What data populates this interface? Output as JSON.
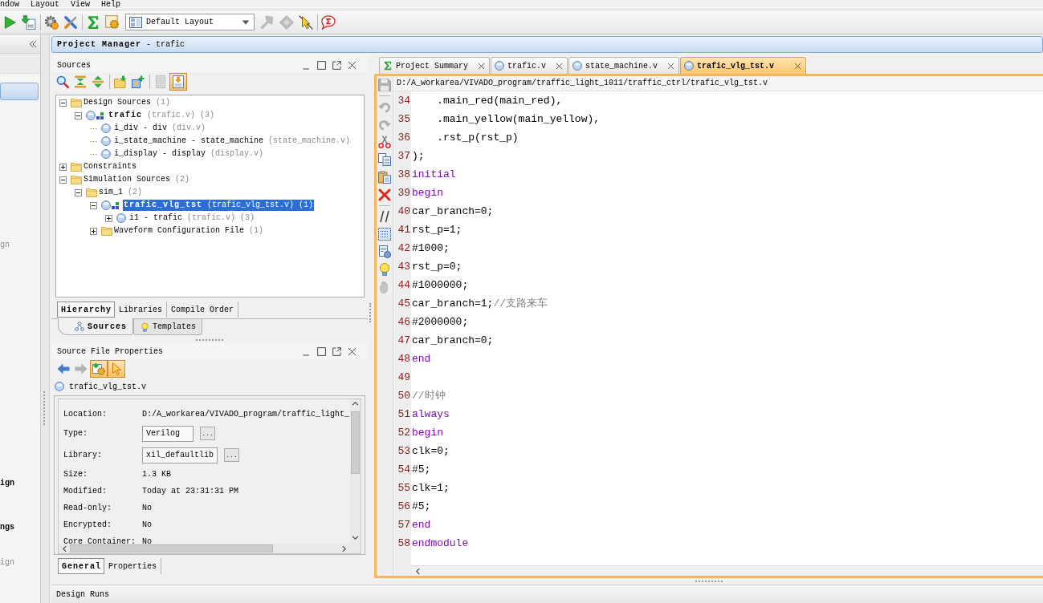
{
  "menu_bar": [
    {
      "label": "ndow"
    },
    {
      "label": "Layout"
    },
    {
      "label": "View"
    },
    {
      "label": "Help"
    }
  ],
  "toolbar": {
    "left_groups": [
      [
        {
          "kind": "run",
          "disabled": false
        },
        {
          "kind": "program",
          "disabled": false
        }
      ],
      [
        {
          "kind": "settings",
          "disabled": false
        },
        {
          "kind": "tools",
          "disabled": false
        }
      ],
      [
        {
          "kind": "summary",
          "disabled": false
        },
        {
          "kind": "ip",
          "disabled": false
        }
      ]
    ],
    "layout_dropdown": {
      "value": "Default Layout"
    },
    "right_groups": [
      [
        {
          "kind": "pin",
          "disabled": true
        },
        {
          "kind": "chip",
          "disabled": true
        },
        {
          "kind": "probe",
          "disabled": false
        }
      ],
      [
        {
          "kind": "chat",
          "disabled": false
        }
      ]
    ]
  },
  "flow_navigator": {
    "items": [
      {
        "selected": true
      },
      {
        "text": "gn",
        "disabled": true,
        "selected": false
      },
      {
        "text": "ign",
        "disabled": false,
        "selected": false
      },
      {
        "text": "ngs",
        "disabled": false,
        "selected": false
      },
      {
        "text": "ign",
        "disabled": true,
        "selected": false
      }
    ]
  },
  "project_manager": {
    "title": "Project Manager",
    "project": "- trafic"
  },
  "sources_panel": {
    "title": "Sources",
    "toolbar_groups": [
      [
        {
          "kind": "search",
          "disabled": false,
          "pressed": false
        },
        {
          "kind": "collapse",
          "disabled": false,
          "pressed": false
        },
        {
          "kind": "expand",
          "disabled": false,
          "pressed": false
        }
      ],
      [
        {
          "kind": "open",
          "disabled": false,
          "pressed": false
        },
        {
          "kind": "add",
          "disabled": false,
          "pressed": false
        }
      ],
      [
        {
          "kind": "help",
          "disabled": true,
          "pressed": false
        },
        {
          "kind": "properties",
          "disabled": false,
          "pressed": true
        }
      ]
    ],
    "tree": [
      {
        "kind": "folder",
        "label": "Design Sources",
        "detail": "(1)",
        "expanded": true,
        "selected": false,
        "children": [
          {
            "kind": "top",
            "label": "trafic",
            "detail": "(trafic.v) (3)",
            "expanded": true,
            "selected": false,
            "children": [
              {
                "kind": "instance",
                "label": "i_div - div",
                "detail": "(div.v)",
                "selected": false
              },
              {
                "kind": "instance",
                "label": "i_state_machine - state_machine",
                "detail": "(state_machine.v)",
                "selected": false
              },
              {
                "kind": "instance",
                "label": "i_display - display",
                "detail": "(display.v)",
                "selected": false
              }
            ]
          }
        ]
      },
      {
        "kind": "folder",
        "label": "Constraints",
        "expanded": false,
        "selected": false
      },
      {
        "kind": "folder",
        "label": "Simulation Sources",
        "detail": "(2)",
        "expanded": true,
        "selected": false,
        "children": [
          {
            "kind": "folder",
            "label": "sim_1",
            "detail": "(2)",
            "expanded": true,
            "selected": false,
            "children": [
              {
                "kind": "top",
                "label": "trafic_vlg_tst",
                "detail": "(trafic_vlg_tst.v) (1)",
                "expanded": true,
                "selected": true,
                "children": [
                  {
                    "kind": "instance",
                    "label": "i1 - trafic",
                    "detail": "(trafic.v) (3)",
                    "expanded": false,
                    "selected": false
                  }
                ]
              },
              {
                "kind": "folder",
                "label": "Waveform Configuration File",
                "detail": "(1)",
                "expanded": false,
                "selected": false
              }
            ]
          }
        ]
      }
    ],
    "view_tabs": [
      {
        "label": "Hierarchy",
        "selected": true
      },
      {
        "label": "Libraries",
        "selected": false
      },
      {
        "label": "Compile Order",
        "selected": false
      }
    ]
  },
  "panel_tabs": [
    {
      "label": "Sources",
      "selected": true
    },
    {
      "label": "Templates",
      "selected": false
    }
  ],
  "properties_panel": {
    "title": "Source File Properties",
    "toolbar": [
      {
        "kind": "back",
        "disabled": false,
        "pressed": false
      },
      {
        "kind": "forward",
        "disabled": true,
        "pressed": false
      },
      {
        "kind": "sync",
        "disabled": false,
        "pressed": true
      },
      {
        "kind": "select",
        "disabled": false,
        "pressed": true
      }
    ],
    "file": "trafic_vlg_tst.v",
    "fields": [
      {
        "kind": "text",
        "label": "Location:",
        "value": "D:/A_workarea/VIVADO_program/traffic_light_"
      },
      {
        "kind": "choice",
        "label": "Type:",
        "value": "Verilog",
        "button": "..."
      },
      {
        "kind": "choice",
        "label": "Library:",
        "value": "xil_defaultlib",
        "button": "..."
      },
      {
        "kind": "text",
        "label": "Size:",
        "value": "1.3 KB"
      },
      {
        "kind": "text",
        "label": "Modified:",
        "value": "Today at 23:31:31 PM"
      },
      {
        "kind": "text",
        "label": "Read-only:",
        "value": "No"
      },
      {
        "kind": "text",
        "label": "Encrypted:",
        "value": "No"
      },
      {
        "kind": "text",
        "label": "Core Container:",
        "value": "No"
      }
    ],
    "tabs": [
      {
        "label": "General",
        "selected": true
      },
      {
        "label": "Properties",
        "selected": false
      }
    ]
  },
  "editor": {
    "tabs": [
      {
        "kind": "summary",
        "label": "Project Summary",
        "selected": false
      },
      {
        "kind": "file",
        "label": "trafic.v",
        "selected": false
      },
      {
        "kind": "file",
        "label": "state_machine.v",
        "selected": false
      },
      {
        "kind": "file",
        "label": "trafic_vlg_tst.v",
        "selected": true
      }
    ],
    "toolbar_groups": [
      [
        {
          "kind": "save",
          "disabled": true
        }
      ],
      [
        {
          "kind": "undo",
          "disabled": true
        },
        {
          "kind": "redo",
          "disabled": true
        },
        {
          "kind": "cut",
          "disabled": false
        },
        {
          "kind": "copy",
          "disabled": false
        },
        {
          "kind": "paste",
          "disabled": false
        },
        {
          "kind": "delete",
          "disabled": false
        }
      ],
      [
        {
          "kind": "comment",
          "disabled": false
        },
        {
          "kind": "column_select",
          "disabled": false
        },
        {
          "kind": "insert",
          "disabled": false
        },
        {
          "kind": "hint",
          "disabled": false
        },
        {
          "kind": "halt",
          "disabled": true
        }
      ]
    ],
    "path": "D:/A_workarea/VIVADO_program/traffic_light_1011/traffic_ctrl/trafic_vlg_tst.v",
    "lines": [
      {
        "number": "34",
        "kind": "plain",
        "code": "    .main_red(main_red),"
      },
      {
        "number": "35",
        "kind": "plain",
        "code": "    .main_yellow(main_yellow),"
      },
      {
        "number": "36",
        "kind": "plain",
        "code": "    .rst_p(rst_p)"
      },
      {
        "number": "37",
        "kind": "plain",
        "code": ");"
      },
      {
        "number": "38",
        "kind": "keyword",
        "code": "initial"
      },
      {
        "number": "39",
        "kind": "keyword",
        "code": "begin"
      },
      {
        "number": "40",
        "kind": "plain",
        "code": "car_branch=0;"
      },
      {
        "number": "41",
        "kind": "plain",
        "code": "rst_p=1;"
      },
      {
        "number": "42",
        "kind": "plain",
        "code": "#1000;"
      },
      {
        "number": "43",
        "kind": "plain",
        "code": "rst_p=0;"
      },
      {
        "number": "44",
        "kind": "plain",
        "code": "#1000000;"
      },
      {
        "number": "45",
        "kind": "plain",
        "code": "car_branch=1;",
        "comment": "//支路来车"
      },
      {
        "number": "46",
        "kind": "plain",
        "code": "#2000000;"
      },
      {
        "number": "47",
        "kind": "plain",
        "code": "car_branch=0;"
      },
      {
        "number": "48",
        "kind": "keyword",
        "code": "end"
      },
      {
        "number": "49"
      },
      {
        "number": "50",
        "comment": "//时钟"
      },
      {
        "number": "51",
        "kind": "keyword",
        "code": "always"
      },
      {
        "number": "52",
        "kind": "keyword",
        "code": "begin"
      },
      {
        "number": "53",
        "kind": "plain",
        "code": "clk=0;"
      },
      {
        "number": "54",
        "kind": "plain",
        "code": "#5;"
      },
      {
        "number": "55",
        "kind": "plain",
        "code": "clk=1;"
      },
      {
        "number": "56",
        "kind": "plain",
        "code": "#5;"
      },
      {
        "number": "57",
        "kind": "keyword",
        "code": "end"
      },
      {
        "number": "58",
        "kind": "keyword",
        "code": "endmodule"
      }
    ]
  },
  "design_runs": {
    "title": "Design Runs"
  }
}
